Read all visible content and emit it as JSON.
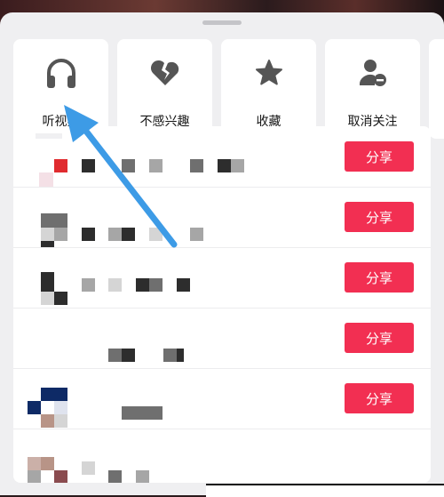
{
  "actions": [
    {
      "label": "听视频",
      "icon": "headphones-icon"
    },
    {
      "label": "不感兴趣",
      "icon": "broken-heart-icon"
    },
    {
      "label": "收藏",
      "icon": "star-icon"
    },
    {
      "label": "取消关注",
      "icon": "unfollow-user-icon"
    }
  ],
  "share_rows": [
    {
      "button": "分享"
    },
    {
      "button": "分享"
    },
    {
      "button": "分享"
    },
    {
      "button": "分享"
    },
    {
      "button": "分享"
    }
  ],
  "colors": {
    "accent": "#f22f52",
    "arrow": "#3d9be6",
    "sheet": "#efeff1"
  }
}
